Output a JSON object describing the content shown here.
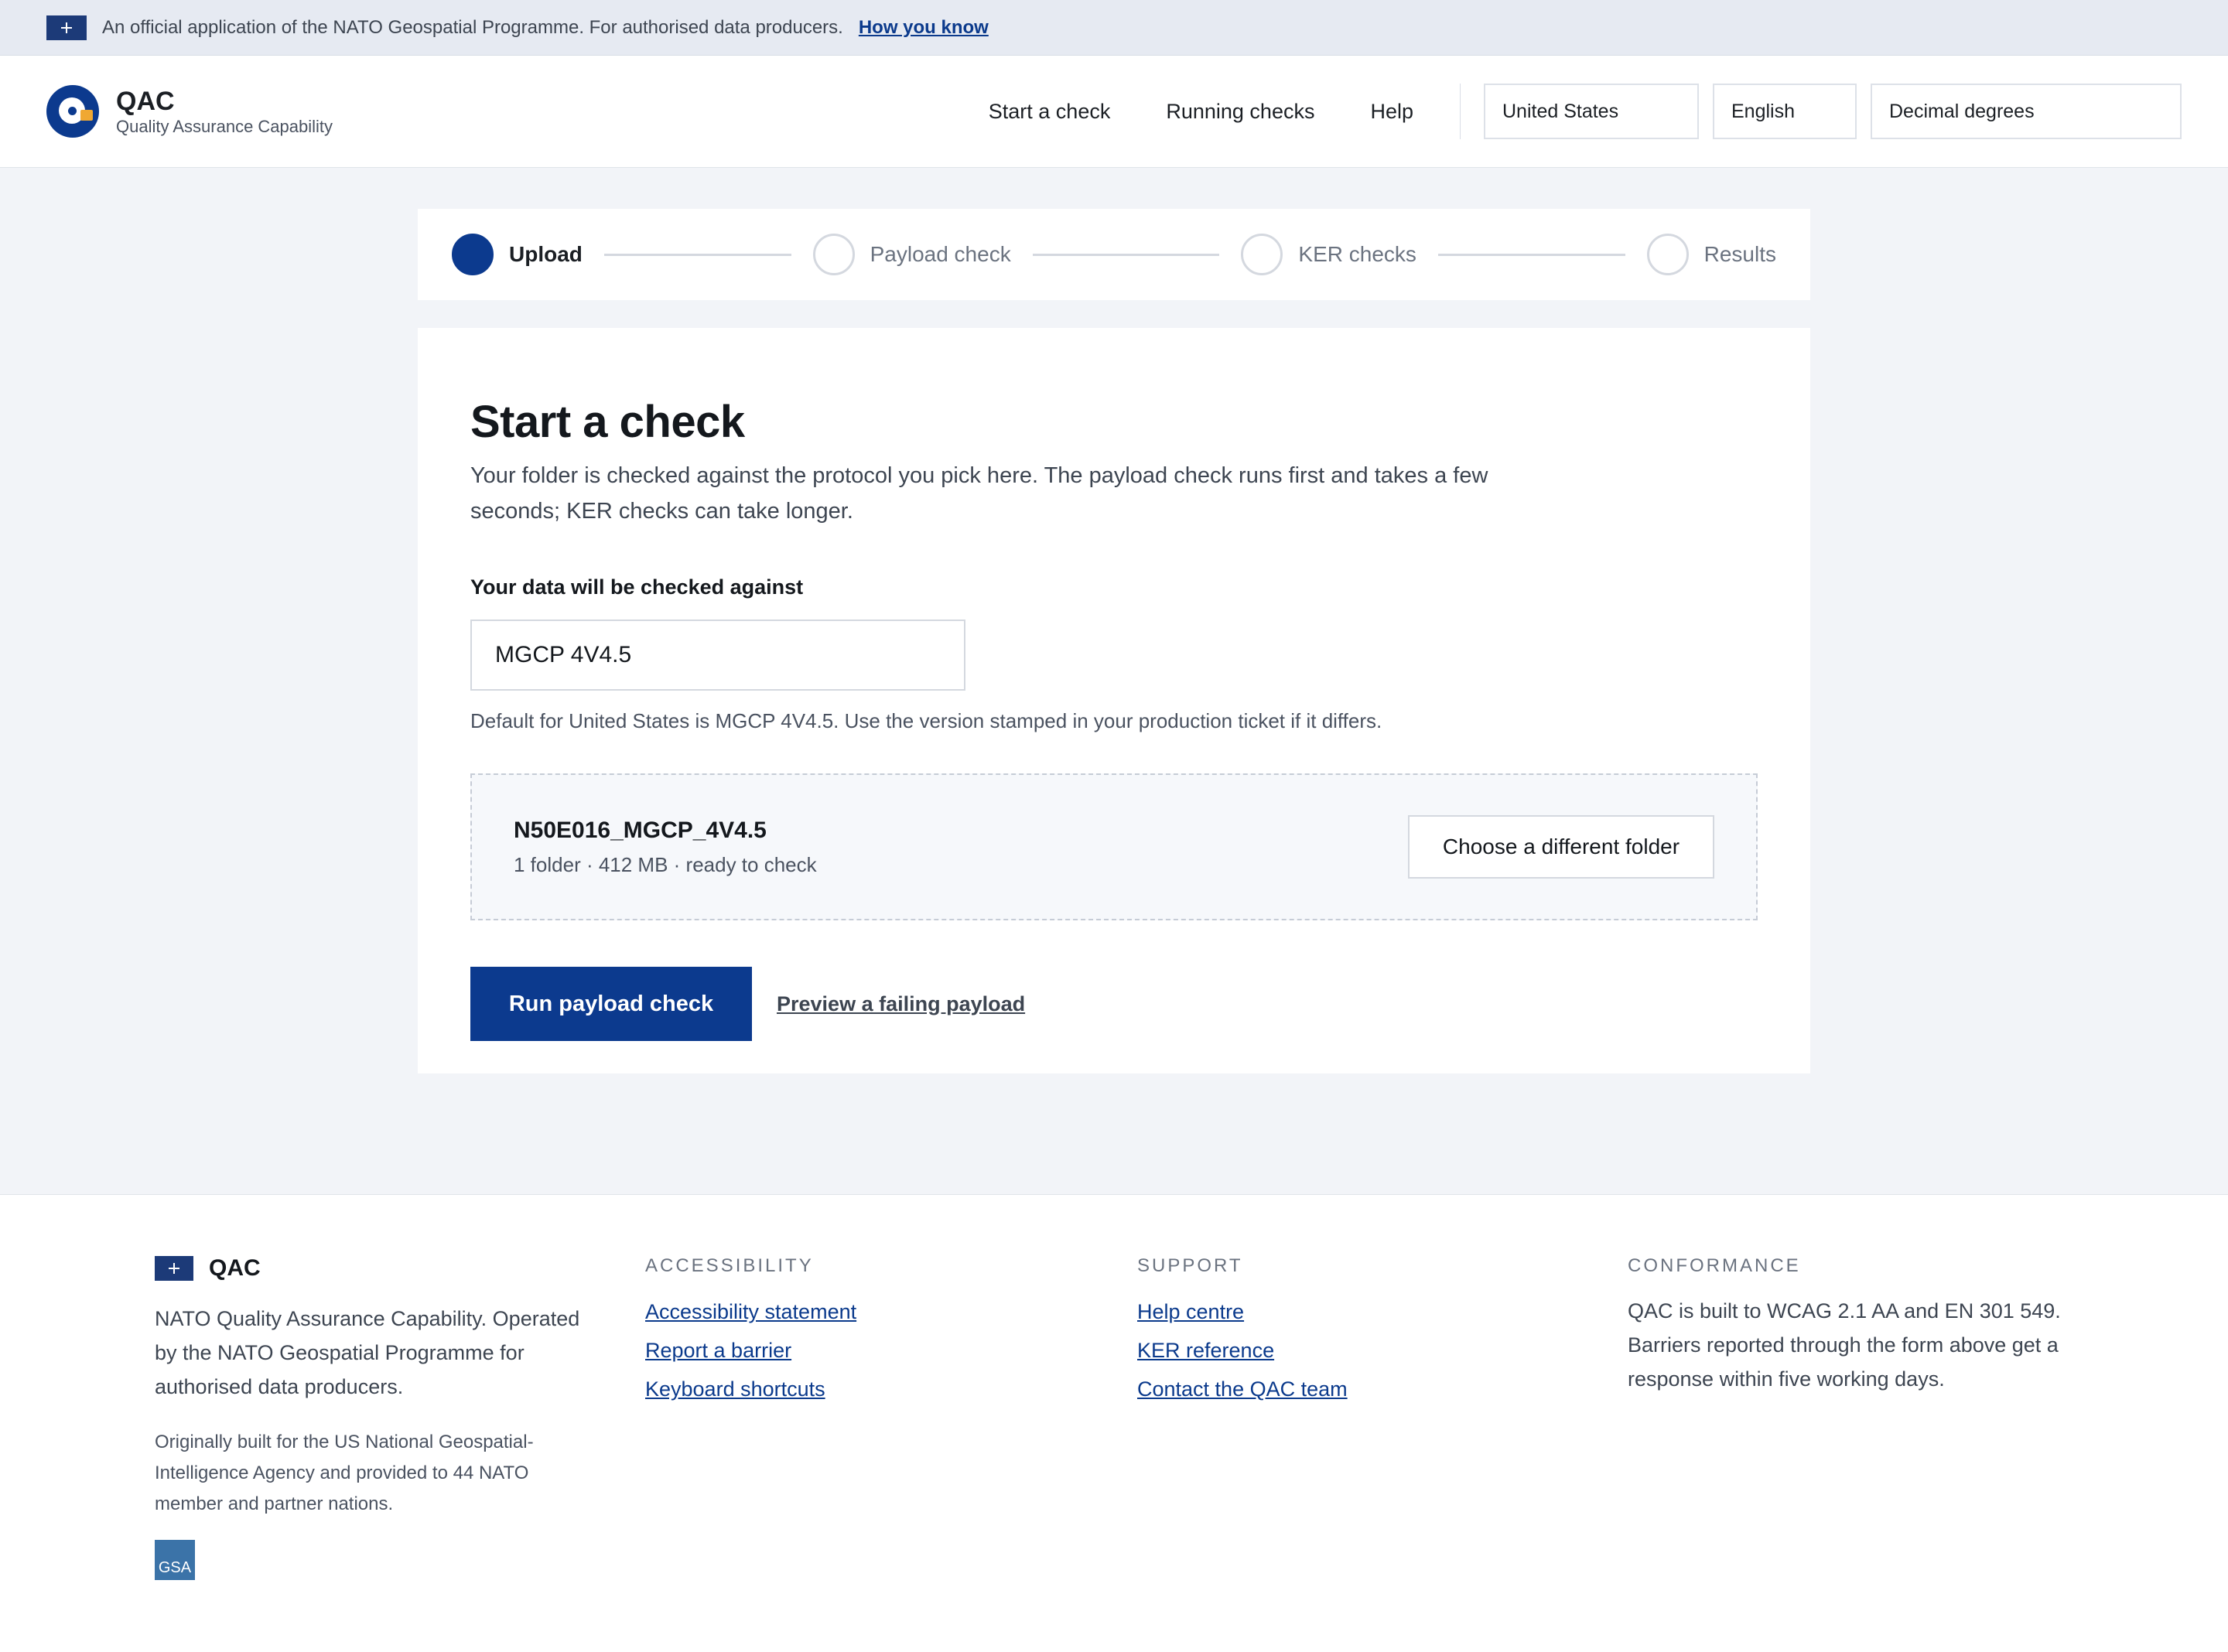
{
  "banner": {
    "text": "An official application of the NATO Geospatial Programme. For authorised data producers.",
    "link": "How you know"
  },
  "header": {
    "brand_name": "QAC",
    "brand_sub": "Quality Assurance Capability",
    "nav": [
      "Start a check",
      "Running checks",
      "Help"
    ],
    "country": "United States",
    "language": "English",
    "coordinates": "Decimal degrees"
  },
  "stepper": {
    "steps": [
      {
        "label": "Upload",
        "state": "active"
      },
      {
        "label": "Payload check",
        "state": "pending"
      },
      {
        "label": "KER checks",
        "state": "pending"
      },
      {
        "label": "Results",
        "state": "pending"
      }
    ]
  },
  "main": {
    "title": "Start a check",
    "lead": "Your folder is checked against the protocol you pick here. The payload check runs first and takes a few seconds; KER checks can take longer.",
    "field_label": "Your data will be checked against",
    "protocol_value": "MGCP 4V4.5",
    "hint": "Default for United States is MGCP 4V4.5. Use the version stamped in your production ticket if it differs.",
    "folder_name": "N50E016_MGCP_4V4.5",
    "folder_meta": "1 folder · 412 MB · ready to check",
    "choose_button": "Choose a different folder",
    "run_button": "Run payload check",
    "preview_link": "Preview a failing payload"
  },
  "footer": {
    "brand_name": "QAC",
    "description": "NATO Quality Assurance Capability. Operated by the NATO Geospatial Programme for authorised data producers.",
    "note": "Originally built for the US National Geospatial-Intelligence Agency and provided to 44 NATO member and partner nations.",
    "gsa_label": "GSA",
    "accessibility": {
      "heading": "Accessibility",
      "links": [
        "Accessibility statement",
        "Report a barrier",
        "Keyboard shortcuts"
      ]
    },
    "support": {
      "heading": "Support",
      "links": [
        "Help centre",
        "KER reference",
        "Contact the QAC team"
      ]
    },
    "conformance": {
      "heading": "Conformance",
      "text": "QAC is built to WCAG 2.1 AA and EN 301 549. Barriers reported through the form above get a response within five working days."
    }
  },
  "colors": {
    "primary": "#0c3a8e",
    "accent": "#f0a832",
    "page_bg": "#f2f4f8"
  }
}
